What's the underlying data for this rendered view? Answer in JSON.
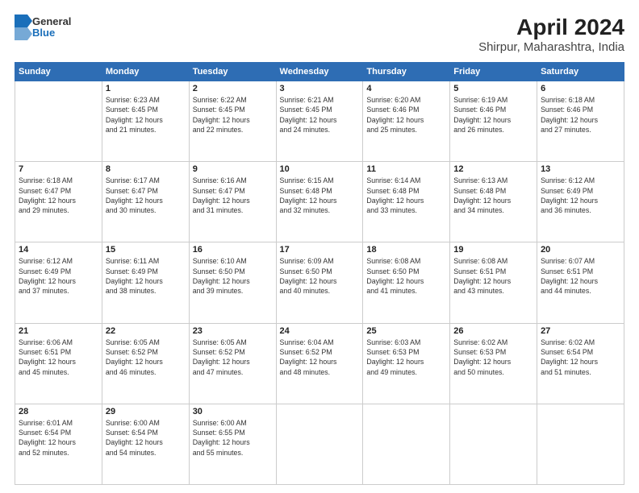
{
  "logo": {
    "line1": "General",
    "line2": "Blue"
  },
  "title": "April 2024",
  "subtitle": "Shirpur, Maharashtra, India",
  "headers": [
    "Sunday",
    "Monday",
    "Tuesday",
    "Wednesday",
    "Thursday",
    "Friday",
    "Saturday"
  ],
  "weeks": [
    [
      {
        "day": "",
        "info": ""
      },
      {
        "day": "1",
        "info": "Sunrise: 6:23 AM\nSunset: 6:45 PM\nDaylight: 12 hours\nand 21 minutes."
      },
      {
        "day": "2",
        "info": "Sunrise: 6:22 AM\nSunset: 6:45 PM\nDaylight: 12 hours\nand 22 minutes."
      },
      {
        "day": "3",
        "info": "Sunrise: 6:21 AM\nSunset: 6:45 PM\nDaylight: 12 hours\nand 24 minutes."
      },
      {
        "day": "4",
        "info": "Sunrise: 6:20 AM\nSunset: 6:46 PM\nDaylight: 12 hours\nand 25 minutes."
      },
      {
        "day": "5",
        "info": "Sunrise: 6:19 AM\nSunset: 6:46 PM\nDaylight: 12 hours\nand 26 minutes."
      },
      {
        "day": "6",
        "info": "Sunrise: 6:18 AM\nSunset: 6:46 PM\nDaylight: 12 hours\nand 27 minutes."
      }
    ],
    [
      {
        "day": "7",
        "info": "Sunrise: 6:18 AM\nSunset: 6:47 PM\nDaylight: 12 hours\nand 29 minutes."
      },
      {
        "day": "8",
        "info": "Sunrise: 6:17 AM\nSunset: 6:47 PM\nDaylight: 12 hours\nand 30 minutes."
      },
      {
        "day": "9",
        "info": "Sunrise: 6:16 AM\nSunset: 6:47 PM\nDaylight: 12 hours\nand 31 minutes."
      },
      {
        "day": "10",
        "info": "Sunrise: 6:15 AM\nSunset: 6:48 PM\nDaylight: 12 hours\nand 32 minutes."
      },
      {
        "day": "11",
        "info": "Sunrise: 6:14 AM\nSunset: 6:48 PM\nDaylight: 12 hours\nand 33 minutes."
      },
      {
        "day": "12",
        "info": "Sunrise: 6:13 AM\nSunset: 6:48 PM\nDaylight: 12 hours\nand 34 minutes."
      },
      {
        "day": "13",
        "info": "Sunrise: 6:12 AM\nSunset: 6:49 PM\nDaylight: 12 hours\nand 36 minutes."
      }
    ],
    [
      {
        "day": "14",
        "info": "Sunrise: 6:12 AM\nSunset: 6:49 PM\nDaylight: 12 hours\nand 37 minutes."
      },
      {
        "day": "15",
        "info": "Sunrise: 6:11 AM\nSunset: 6:49 PM\nDaylight: 12 hours\nand 38 minutes."
      },
      {
        "day": "16",
        "info": "Sunrise: 6:10 AM\nSunset: 6:50 PM\nDaylight: 12 hours\nand 39 minutes."
      },
      {
        "day": "17",
        "info": "Sunrise: 6:09 AM\nSunset: 6:50 PM\nDaylight: 12 hours\nand 40 minutes."
      },
      {
        "day": "18",
        "info": "Sunrise: 6:08 AM\nSunset: 6:50 PM\nDaylight: 12 hours\nand 41 minutes."
      },
      {
        "day": "19",
        "info": "Sunrise: 6:08 AM\nSunset: 6:51 PM\nDaylight: 12 hours\nand 43 minutes."
      },
      {
        "day": "20",
        "info": "Sunrise: 6:07 AM\nSunset: 6:51 PM\nDaylight: 12 hours\nand 44 minutes."
      }
    ],
    [
      {
        "day": "21",
        "info": "Sunrise: 6:06 AM\nSunset: 6:51 PM\nDaylight: 12 hours\nand 45 minutes."
      },
      {
        "day": "22",
        "info": "Sunrise: 6:05 AM\nSunset: 6:52 PM\nDaylight: 12 hours\nand 46 minutes."
      },
      {
        "day": "23",
        "info": "Sunrise: 6:05 AM\nSunset: 6:52 PM\nDaylight: 12 hours\nand 47 minutes."
      },
      {
        "day": "24",
        "info": "Sunrise: 6:04 AM\nSunset: 6:52 PM\nDaylight: 12 hours\nand 48 minutes."
      },
      {
        "day": "25",
        "info": "Sunrise: 6:03 AM\nSunset: 6:53 PM\nDaylight: 12 hours\nand 49 minutes."
      },
      {
        "day": "26",
        "info": "Sunrise: 6:02 AM\nSunset: 6:53 PM\nDaylight: 12 hours\nand 50 minutes."
      },
      {
        "day": "27",
        "info": "Sunrise: 6:02 AM\nSunset: 6:54 PM\nDaylight: 12 hours\nand 51 minutes."
      }
    ],
    [
      {
        "day": "28",
        "info": "Sunrise: 6:01 AM\nSunset: 6:54 PM\nDaylight: 12 hours\nand 52 minutes."
      },
      {
        "day": "29",
        "info": "Sunrise: 6:00 AM\nSunset: 6:54 PM\nDaylight: 12 hours\nand 54 minutes."
      },
      {
        "day": "30",
        "info": "Sunrise: 6:00 AM\nSunset: 6:55 PM\nDaylight: 12 hours\nand 55 minutes."
      },
      {
        "day": "",
        "info": ""
      },
      {
        "day": "",
        "info": ""
      },
      {
        "day": "",
        "info": ""
      },
      {
        "day": "",
        "info": ""
      }
    ]
  ]
}
